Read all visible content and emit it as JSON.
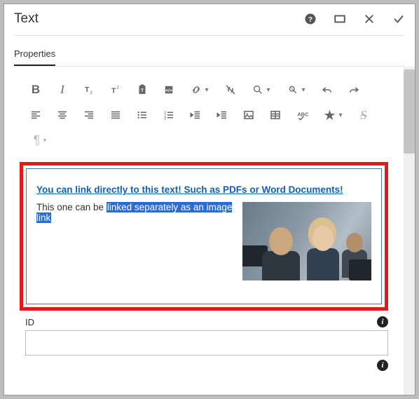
{
  "title": "Text",
  "tab": "Properties",
  "toolbar": {
    "bold": "B",
    "italic": "I"
  },
  "editor": {
    "link_text": "You can link directly to this text! Such as PDFs or Word Documents!",
    "line2_prefix": "This one can be ",
    "line2_selected": "linked separately as an image link"
  },
  "field": {
    "label": "ID",
    "value": ""
  }
}
